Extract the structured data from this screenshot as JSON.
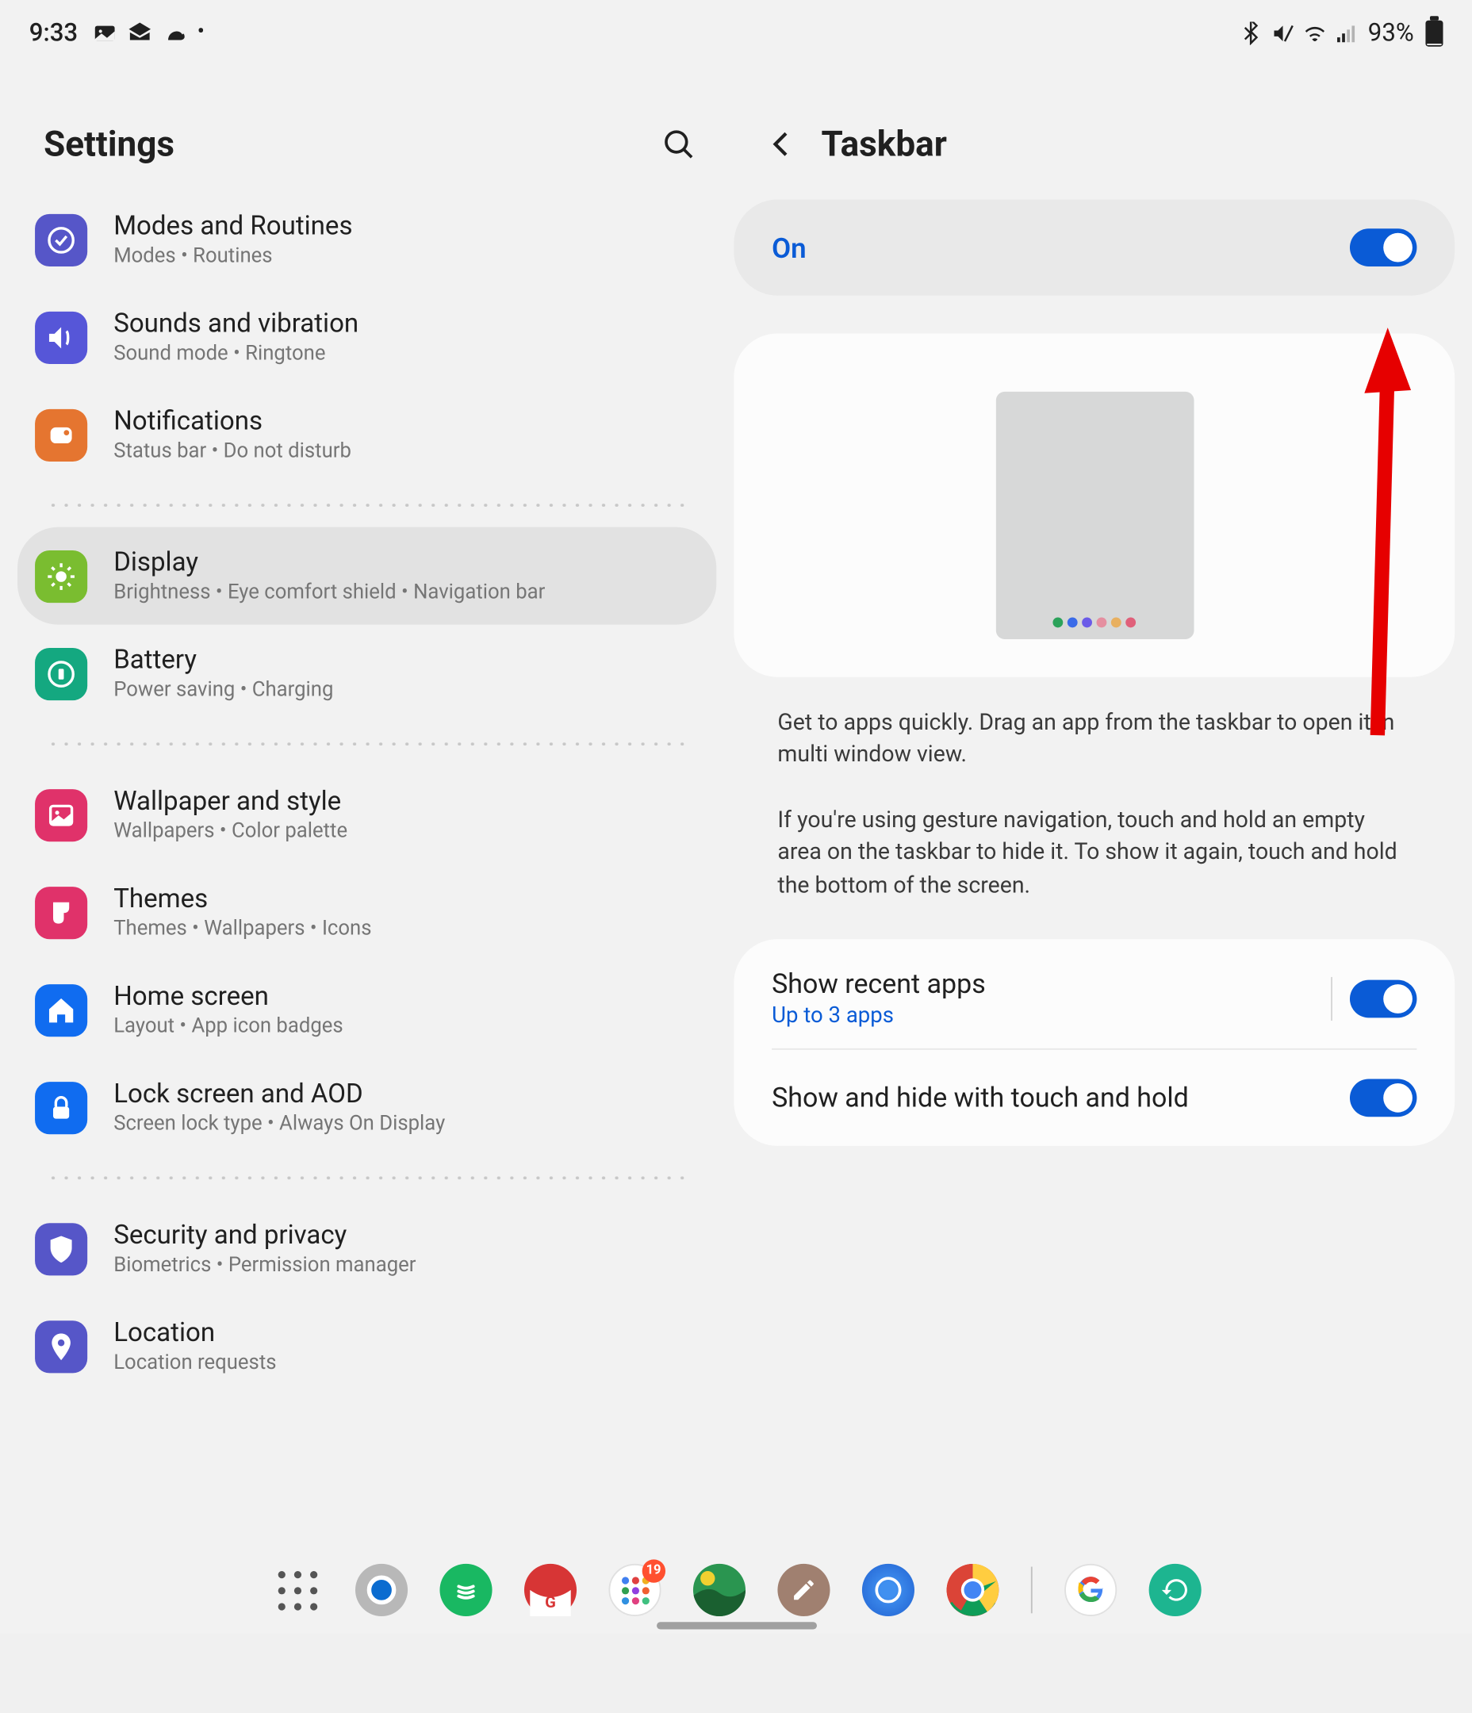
{
  "status": {
    "time": "9:33",
    "battery": "93%"
  },
  "left": {
    "title": "Settings",
    "items": [
      {
        "title": "Modes and Routines",
        "subtitle": "Modes  •  Routines",
        "color": "#5656c8",
        "icon": "check-circle"
      },
      {
        "title": "Sounds and vibration",
        "subtitle": "Sound mode  •  Ringtone",
        "color": "#5656d8",
        "icon": "volume"
      },
      {
        "title": "Notifications",
        "subtitle": "Status bar  •  Do not disturb",
        "color": "#e57530",
        "icon": "notif"
      },
      {
        "divider": true
      },
      {
        "title": "Display",
        "subtitle": "Brightness  •  Eye comfort shield  •  Navigation bar",
        "color": "#7abd30",
        "icon": "brightness",
        "selected": true
      },
      {
        "title": "Battery",
        "subtitle": "Power saving  •  Charging",
        "color": "#14a880",
        "icon": "battery-circ"
      },
      {
        "divider": true
      },
      {
        "title": "Wallpaper and style",
        "subtitle": "Wallpapers  •  Color palette",
        "color": "#e0326a",
        "icon": "image"
      },
      {
        "title": "Themes",
        "subtitle": "Themes  •  Wallpapers  •  Icons",
        "color": "#e0326a",
        "icon": "brush"
      },
      {
        "title": "Home screen",
        "subtitle": "Layout  •  App icon badges",
        "color": "#106cf0",
        "icon": "home"
      },
      {
        "title": "Lock screen and AOD",
        "subtitle": "Screen lock type  •  Always On Display",
        "color": "#106cf0",
        "icon": "lock"
      },
      {
        "divider": true
      },
      {
        "title": "Security and privacy",
        "subtitle": "Biometrics  •  Permission manager",
        "color": "#5656c8",
        "icon": "shield"
      },
      {
        "title": "Location",
        "subtitle": "Location requests",
        "color": "#5656c8",
        "icon": "pin"
      }
    ]
  },
  "right": {
    "title": "Taskbar",
    "toggle": {
      "label": "On",
      "state": true
    },
    "description1": "Get to apps quickly. Drag an app from the taskbar to open it in multi window view.",
    "description2": "If you're using gesture navigation, touch and hold an empty area on the taskbar to hide it. To show it again, touch and hold the bottom of the screen.",
    "options": [
      {
        "title": "Show recent apps",
        "subtitle": "Up to 3 apps",
        "state": true,
        "hasDivider": true
      },
      {
        "title": "Show and hide with touch and hold",
        "state": true
      }
    ]
  },
  "taskbar": {
    "badge": "19"
  }
}
